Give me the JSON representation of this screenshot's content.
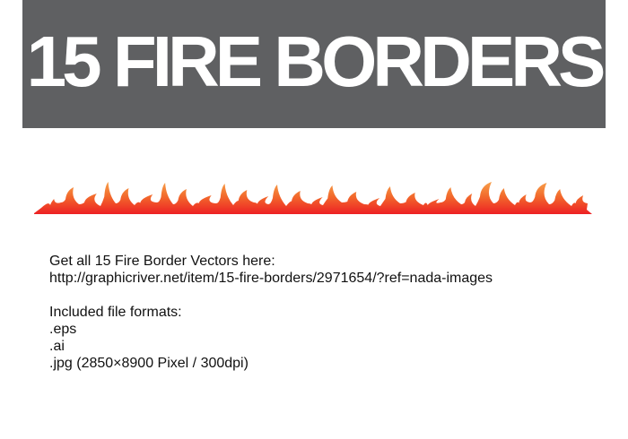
{
  "banner": {
    "title": "15 FIRE BORDERS",
    "background_color": "#5f6062"
  },
  "fire_border": {
    "icon": "fire-border-icon",
    "colors": [
      "#ed2024",
      "#f26a2c",
      "#f7a04a"
    ]
  },
  "info": {
    "intro": "Get all 15 Fire Border Vectors here:",
    "url": "http://graphicriver.net/item/15-fire-borders/2971654/?ref=nada-images",
    "formats_heading": "Included file formats:",
    "formats": [
      ".eps",
      ".ai",
      ".jpg (2850×8900 Pixel / 300dpi)"
    ]
  }
}
